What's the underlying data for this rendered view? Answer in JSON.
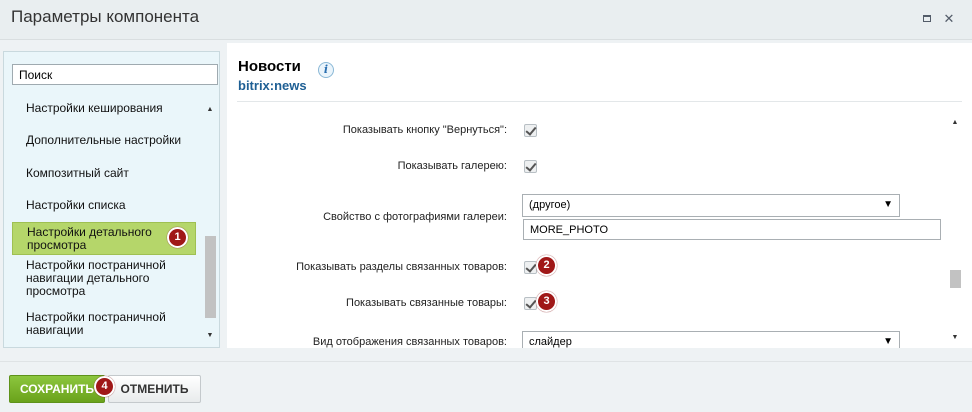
{
  "dialog": {
    "title": "Параметры компонента",
    "maximize_icon": "maximize-icon",
    "close_icon": "close-icon",
    "close_glyph": "✕"
  },
  "sidebar": {
    "search_placeholder": "Поиск",
    "items": [
      {
        "label": "Настройки кеширования"
      },
      {
        "label": "Дополнительные настройки"
      },
      {
        "label": "Композитный сайт"
      },
      {
        "label": "Настройки списка"
      },
      {
        "label": "Настройки детального просмотра",
        "active": true
      },
      {
        "label": "Настройки постраничной навигации детального просмотра"
      },
      {
        "label": "Настройки постраничной навигации"
      }
    ]
  },
  "component": {
    "title": "Новости",
    "code": "bitrix:news",
    "info_icon": "i"
  },
  "form": {
    "back_button_label": "Показывать кнопку \"Вернуться\":",
    "back_button_checked": true,
    "gallery_label": "Показывать галерею:",
    "gallery_checked": true,
    "gallery_property_label": "Свойство с фотографиями галереи:",
    "gallery_property_value": "(другое)",
    "gallery_property_custom": "MORE_PHOTO",
    "related_sections_label": "Показывать разделы связанных товаров:",
    "related_sections_checked": true,
    "related_products_label": "Показывать связанные товары:",
    "related_products_checked": true,
    "related_view_label": "Вид отображения связанных товаров:",
    "related_view_value": "слайдер",
    "caret": "▼"
  },
  "badges": [
    "1",
    "2",
    "3",
    "4"
  ],
  "footer": {
    "save_label": "СОХРАНИТЬ",
    "cancel_label": "ОТМЕНИТЬ"
  },
  "colors": {
    "save_button": "#7ab32e",
    "active_item": "#b5d66a",
    "badge": "#a01818",
    "component_code": "#1e5f94"
  }
}
